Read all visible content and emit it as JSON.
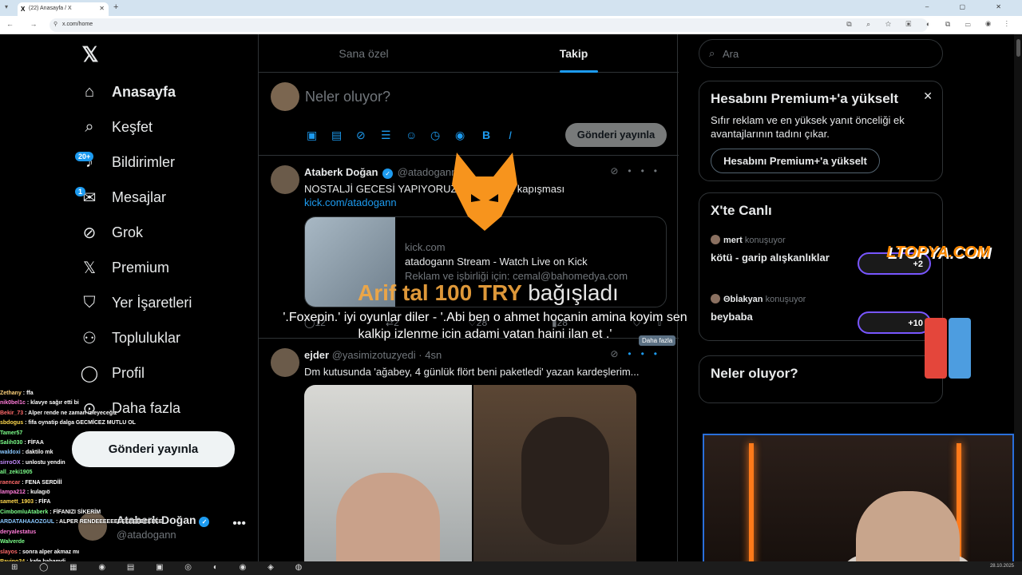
{
  "browser": {
    "tab_title": "(22) Anasayfa / X",
    "url": "x.com/home"
  },
  "nav": {
    "items": [
      {
        "label": "Anasayfa",
        "icon": "home-icon"
      },
      {
        "label": "Keşfet",
        "icon": "search-icon"
      },
      {
        "label": "Bildirimler",
        "icon": "bell-icon",
        "badge": "20+"
      },
      {
        "label": "Mesajlar",
        "icon": "mail-icon",
        "badge": "1"
      },
      {
        "label": "Grok",
        "icon": "grok-icon"
      },
      {
        "label": "Premium",
        "icon": "x-icon"
      },
      {
        "label": "Yer İşaretleri",
        "icon": "bookmark-icon"
      },
      {
        "label": "Topluluklar",
        "icon": "people-icon"
      },
      {
        "label": "Profil",
        "icon": "user-icon"
      },
      {
        "label": "Daha fazla",
        "icon": "more-circle-icon"
      }
    ],
    "post_button": "Gönderi yayınla",
    "user": {
      "name": "Ataberk Doğan",
      "handle": "@atadogann"
    }
  },
  "main": {
    "tabs": [
      {
        "label": "Sana özel"
      },
      {
        "label": "Takip"
      }
    ],
    "composer": {
      "placeholder": "Neler oluyor?",
      "submit": "Gönderi yayınla"
    },
    "tweets": [
      {
        "name": "Ataberk Doğan",
        "handle": "@atadogann",
        "text": "NOSTALJİ GECESİ YAPIYORUZ. ...EL ... koç kapışması",
        "link": "kick.com/atadogann",
        "card": {
          "domain": "kick.com",
          "title": "atadogann Stream - Watch Live on Kick",
          "desc": "Reklam ve işbirliği için: cemal@bahomedya.com"
        },
        "replies": "12",
        "retweets": "2",
        "likes": "28",
        "views": "28"
      },
      {
        "name": "ejder",
        "handle": "@yasimizotuzyedi · 4sn",
        "text": "Dm kutusunda 'ağabey, 4 günlük flört beni paketledi' yazan kardeşlerim..."
      }
    ],
    "tooltip": "Daha fazla"
  },
  "right": {
    "search_placeholder": "Ara",
    "premium": {
      "title": "Hesabını Premium+'a yükselt",
      "desc": "Sıfır reklam ve en yüksek yanıt önceliği ek avantajlarının tadını çıkar.",
      "button": "Hesabını Premium+'a yükselt"
    },
    "live": {
      "title": "X'te Canlı",
      "items": [
        {
          "user": "mert",
          "suffix": "konuşuyor",
          "title": "kötü - garip alışkanlıklar",
          "count": "+2"
        },
        {
          "user": "Θbİakyan",
          "suffix": "konuşuyor",
          "title": "beybaba",
          "count": "+10"
        }
      ]
    },
    "trends_title": "Neler oluyor?"
  },
  "overlay": {
    "donation_name": "Arif tal 100 TRY",
    "donation_word": "bağışladı",
    "donation_msg": "'.Foxepin.' iyi oyunlar diler - '.Abi ben o ahmet hocanin amina koyim sen kalkip izlenme icin adami vatan haini ilan et .'",
    "sponsor": "LTOPYA.COM",
    "chat": [
      {
        "user": "Zethany",
        "msg": "ffa",
        "color": "#ffd27a"
      },
      {
        "user": "nik0bel1c",
        "msg": "klavye sağır etti bi",
        "color": "#ff7bd8"
      },
      {
        "user": "Bekir_73",
        "msg": "Alper rende ne zaman izleyeceğiz",
        "color": "#ff6a6a"
      },
      {
        "user": "sbdogus",
        "msg": "fifa oynatip dalga GECMİCEZ MUTLU OL",
        "color": "#ffd84d"
      },
      {
        "user": "Tamer57",
        "msg": "",
        "color": "#7cff8a"
      },
      {
        "user": "Salih030",
        "msg": "FİFAA",
        "color": "#7cff8a"
      },
      {
        "user": "waldoxi",
        "msg": "daktilo mk",
        "color": "#8ac8ff"
      },
      {
        "user": "sirroOX",
        "msg": "unlostu yendin",
        "color": "#c58cff"
      },
      {
        "user": "all_zeki1905",
        "msg": "",
        "color": "#7cff8a"
      },
      {
        "user": "raencar",
        "msg": "FENA SERDİİİ",
        "color": "#ff6a6a"
      },
      {
        "user": "lampa212",
        "msg": "kulagıö",
        "color": "#ff7bd8"
      },
      {
        "user": "samett_1903",
        "msg": "FİFA",
        "color": "#ffd84d"
      },
      {
        "user": "CimbomluAtaberk",
        "msg": "FİFANIZI SİKERİM",
        "color": "#7cff8a"
      },
      {
        "user": "ARDATAHAAOZGUL",
        "msg": "ALPER RENDEEEEEEEEEEEEEEEEEE",
        "color": "#8ac8ff"
      },
      {
        "user": "deryalestatus",
        "msg": "",
        "color": "#ff7bd8"
      },
      {
        "user": "Walverde",
        "msg": "",
        "color": "#7cff8a"
      },
      {
        "user": "slayos",
        "msg": "sonra alper akmaz mı",
        "color": "#ff6a6a"
      },
      {
        "user": "Ravino34",
        "msg": "kafe babamdi",
        "color": "#ffd84d"
      }
    ]
  },
  "taskbar": {
    "date": "28.10.2025"
  }
}
